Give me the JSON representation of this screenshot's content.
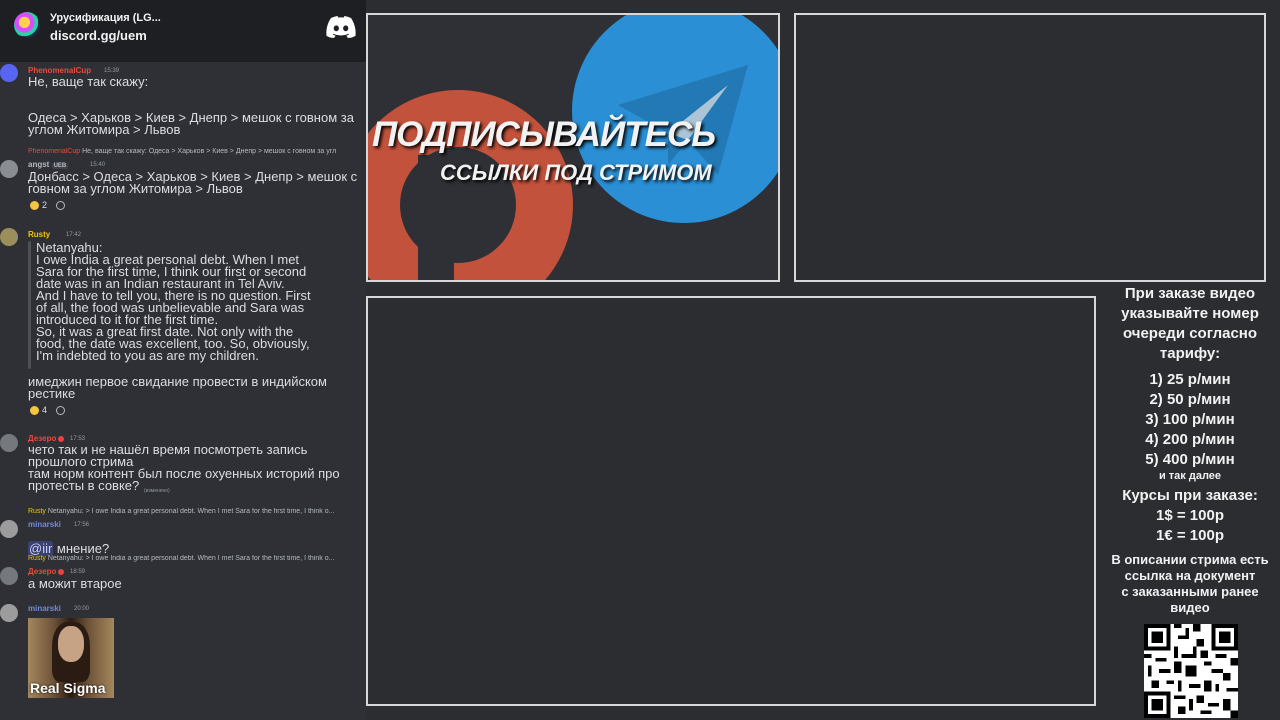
{
  "header": {
    "server_name": "Урусификация (LG...",
    "invite": "discord.gg/uem"
  },
  "messages": [
    {
      "author": "PhenomenalCup",
      "time": "15:39",
      "author_color": "#e74c3c",
      "line1": "Не, ваще так скажу:",
      "line2": "Одеса > Харьков > Киев > Днепр > мешок с говном за\nуглом Житомира > Львов"
    },
    {
      "reply_author": "PhenomenalCup",
      "reply_text": "Не, ваще так скажу:  Одеса > Харьков > Киев > Днепр > мешок с говном за угл",
      "author": "angst",
      "tag": "UEB",
      "time": "15:40",
      "author_color": "#b5bac1",
      "text": "Донбасс > Одеса > Харьков > Киев > Днепр > мешок с\nговном за углом Житомира > Львов",
      "reaction_count": "2"
    },
    {
      "author": "Rusty",
      "time": "17:42",
      "author_color": "#f1c40f",
      "quote": "Netanyahu:\nI owe India a great personal debt. When I met\nSara for the first time, I think our first or second\ndate was in an Indian restaurant in Tel Aviv.\nAnd I have to tell you, there is no question. First\nof all, the food was unbelievable and Sara was\nintroduced to it for the first time.\nSo, it was a great first date. Not only with the\nfood, the date was excellent, too. So, obviously,\nI'm indebted to you as are my children.",
      "text": "имеджин первое свидание провести в индийском\nрестике",
      "reaction_count": "4"
    },
    {
      "author": "Дезерo",
      "time": "17:53",
      "author_color": "#e74c3c",
      "text": "чето так и не нашёл время посмотреть запись\nпрошлого стрима\nтам норм контент был после охуенных историй про\nпротесты в совке?",
      "edited": "(изменено)"
    },
    {
      "reply_author": "Rusty",
      "reply_text": "Netanyahu: > I owe India a great personal debt. When I met Sara for the first time, I think o...",
      "author": "minarski",
      "time": "17:56",
      "author_color": "#7289da",
      "mention": "@iir",
      "text": " мнение?"
    },
    {
      "reply_author": "Rusty",
      "reply_text": "Netanyahu: > I owe India a great personal debt. When I met Sara for the first time, I think o...",
      "author": "Дезерo",
      "time": "18:59",
      "author_color": "#e74c3c",
      "text": "а можит втарое"
    },
    {
      "author": "minarski",
      "time": "20:00",
      "author_color": "#7289da",
      "gif_caption": "Real Sigma"
    }
  ],
  "banner": {
    "title": "ПОДПИСЫВАЙТЕСЬ",
    "subtitle": "ССЫЛКИ ПОД СТРИМОМ",
    "colors": {
      "patreon": "#c2523b",
      "telegram": "#2a8fd4"
    }
  },
  "info": {
    "l1": "При заказе видео",
    "l2": "указывайте номер",
    "l3": "очереди согласно",
    "l4": "тарифу:",
    "t1": "1) 25 р/мин",
    "t2": "2) 50 р/мин",
    "t3": "3) 100 р/мин",
    "t4": "4) 200 р/мин",
    "t5": "5) 400 р/мин",
    "etc": "и так далее",
    "rates_title": "Курсы при заказе:",
    "r1": "1$ = 100р",
    "r2": "1€ = 100р",
    "d1": "В описании стрима есть",
    "d2": "ссылка на документ",
    "d3": "с заказанными ранее",
    "d4": "видео"
  }
}
